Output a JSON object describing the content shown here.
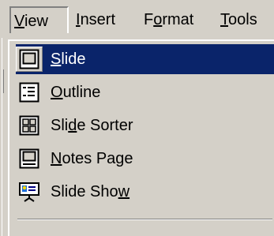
{
  "menubar": {
    "items": [
      {
        "label_pre": "",
        "mnemonic": "V",
        "label_post": "iew"
      },
      {
        "label_pre": "",
        "mnemonic": "I",
        "label_post": "nsert"
      },
      {
        "label_pre": "F",
        "mnemonic": "o",
        "label_post": "rmat"
      },
      {
        "label_pre": "",
        "mnemonic": "T",
        "label_post": "ools"
      }
    ]
  },
  "view_menu": {
    "items": [
      {
        "label_pre": "",
        "mnemonic": "S",
        "label_post": "lide",
        "icon": "slide-view-icon",
        "selected": true
      },
      {
        "label_pre": "",
        "mnemonic": "O",
        "label_post": "utline",
        "icon": "outline-view-icon",
        "selected": false
      },
      {
        "label_pre": "Sli",
        "mnemonic": "d",
        "label_post": "e Sorter",
        "icon": "slide-sorter-icon",
        "selected": false
      },
      {
        "label_pre": "",
        "mnemonic": "N",
        "label_post": "otes Page",
        "icon": "notes-page-icon",
        "selected": false
      },
      {
        "label_pre": "Slide Sho",
        "mnemonic": "w",
        "label_post": "",
        "icon": "slide-show-icon",
        "selected": false
      }
    ]
  },
  "colors": {
    "face": "#d4d0c8",
    "selection": "#0a246a",
    "shadow": "#808080",
    "highlight": "#ffffff"
  }
}
